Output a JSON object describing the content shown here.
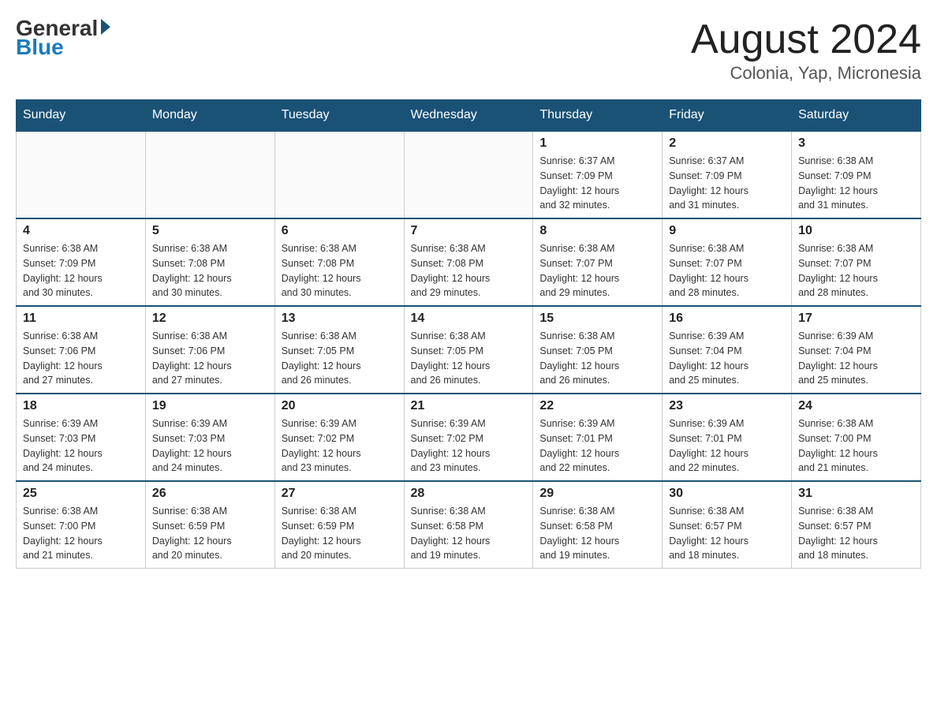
{
  "header": {
    "logo_general": "General",
    "logo_blue": "Blue",
    "title": "August 2024",
    "subtitle": "Colonia, Yap, Micronesia"
  },
  "days_of_week": [
    "Sunday",
    "Monday",
    "Tuesday",
    "Wednesday",
    "Thursday",
    "Friday",
    "Saturday"
  ],
  "weeks": [
    [
      {
        "day": "",
        "info": ""
      },
      {
        "day": "",
        "info": ""
      },
      {
        "day": "",
        "info": ""
      },
      {
        "day": "",
        "info": ""
      },
      {
        "day": "1",
        "info": "Sunrise: 6:37 AM\nSunset: 7:09 PM\nDaylight: 12 hours\nand 32 minutes."
      },
      {
        "day": "2",
        "info": "Sunrise: 6:37 AM\nSunset: 7:09 PM\nDaylight: 12 hours\nand 31 minutes."
      },
      {
        "day": "3",
        "info": "Sunrise: 6:38 AM\nSunset: 7:09 PM\nDaylight: 12 hours\nand 31 minutes."
      }
    ],
    [
      {
        "day": "4",
        "info": "Sunrise: 6:38 AM\nSunset: 7:09 PM\nDaylight: 12 hours\nand 30 minutes."
      },
      {
        "day": "5",
        "info": "Sunrise: 6:38 AM\nSunset: 7:08 PM\nDaylight: 12 hours\nand 30 minutes."
      },
      {
        "day": "6",
        "info": "Sunrise: 6:38 AM\nSunset: 7:08 PM\nDaylight: 12 hours\nand 30 minutes."
      },
      {
        "day": "7",
        "info": "Sunrise: 6:38 AM\nSunset: 7:08 PM\nDaylight: 12 hours\nand 29 minutes."
      },
      {
        "day": "8",
        "info": "Sunrise: 6:38 AM\nSunset: 7:07 PM\nDaylight: 12 hours\nand 29 minutes."
      },
      {
        "day": "9",
        "info": "Sunrise: 6:38 AM\nSunset: 7:07 PM\nDaylight: 12 hours\nand 28 minutes."
      },
      {
        "day": "10",
        "info": "Sunrise: 6:38 AM\nSunset: 7:07 PM\nDaylight: 12 hours\nand 28 minutes."
      }
    ],
    [
      {
        "day": "11",
        "info": "Sunrise: 6:38 AM\nSunset: 7:06 PM\nDaylight: 12 hours\nand 27 minutes."
      },
      {
        "day": "12",
        "info": "Sunrise: 6:38 AM\nSunset: 7:06 PM\nDaylight: 12 hours\nand 27 minutes."
      },
      {
        "day": "13",
        "info": "Sunrise: 6:38 AM\nSunset: 7:05 PM\nDaylight: 12 hours\nand 26 minutes."
      },
      {
        "day": "14",
        "info": "Sunrise: 6:38 AM\nSunset: 7:05 PM\nDaylight: 12 hours\nand 26 minutes."
      },
      {
        "day": "15",
        "info": "Sunrise: 6:38 AM\nSunset: 7:05 PM\nDaylight: 12 hours\nand 26 minutes."
      },
      {
        "day": "16",
        "info": "Sunrise: 6:39 AM\nSunset: 7:04 PM\nDaylight: 12 hours\nand 25 minutes."
      },
      {
        "day": "17",
        "info": "Sunrise: 6:39 AM\nSunset: 7:04 PM\nDaylight: 12 hours\nand 25 minutes."
      }
    ],
    [
      {
        "day": "18",
        "info": "Sunrise: 6:39 AM\nSunset: 7:03 PM\nDaylight: 12 hours\nand 24 minutes."
      },
      {
        "day": "19",
        "info": "Sunrise: 6:39 AM\nSunset: 7:03 PM\nDaylight: 12 hours\nand 24 minutes."
      },
      {
        "day": "20",
        "info": "Sunrise: 6:39 AM\nSunset: 7:02 PM\nDaylight: 12 hours\nand 23 minutes."
      },
      {
        "day": "21",
        "info": "Sunrise: 6:39 AM\nSunset: 7:02 PM\nDaylight: 12 hours\nand 23 minutes."
      },
      {
        "day": "22",
        "info": "Sunrise: 6:39 AM\nSunset: 7:01 PM\nDaylight: 12 hours\nand 22 minutes."
      },
      {
        "day": "23",
        "info": "Sunrise: 6:39 AM\nSunset: 7:01 PM\nDaylight: 12 hours\nand 22 minutes."
      },
      {
        "day": "24",
        "info": "Sunrise: 6:38 AM\nSunset: 7:00 PM\nDaylight: 12 hours\nand 21 minutes."
      }
    ],
    [
      {
        "day": "25",
        "info": "Sunrise: 6:38 AM\nSunset: 7:00 PM\nDaylight: 12 hours\nand 21 minutes."
      },
      {
        "day": "26",
        "info": "Sunrise: 6:38 AM\nSunset: 6:59 PM\nDaylight: 12 hours\nand 20 minutes."
      },
      {
        "day": "27",
        "info": "Sunrise: 6:38 AM\nSunset: 6:59 PM\nDaylight: 12 hours\nand 20 minutes."
      },
      {
        "day": "28",
        "info": "Sunrise: 6:38 AM\nSunset: 6:58 PM\nDaylight: 12 hours\nand 19 minutes."
      },
      {
        "day": "29",
        "info": "Sunrise: 6:38 AM\nSunset: 6:58 PM\nDaylight: 12 hours\nand 19 minutes."
      },
      {
        "day": "30",
        "info": "Sunrise: 6:38 AM\nSunset: 6:57 PM\nDaylight: 12 hours\nand 18 minutes."
      },
      {
        "day": "31",
        "info": "Sunrise: 6:38 AM\nSunset: 6:57 PM\nDaylight: 12 hours\nand 18 minutes."
      }
    ]
  ]
}
